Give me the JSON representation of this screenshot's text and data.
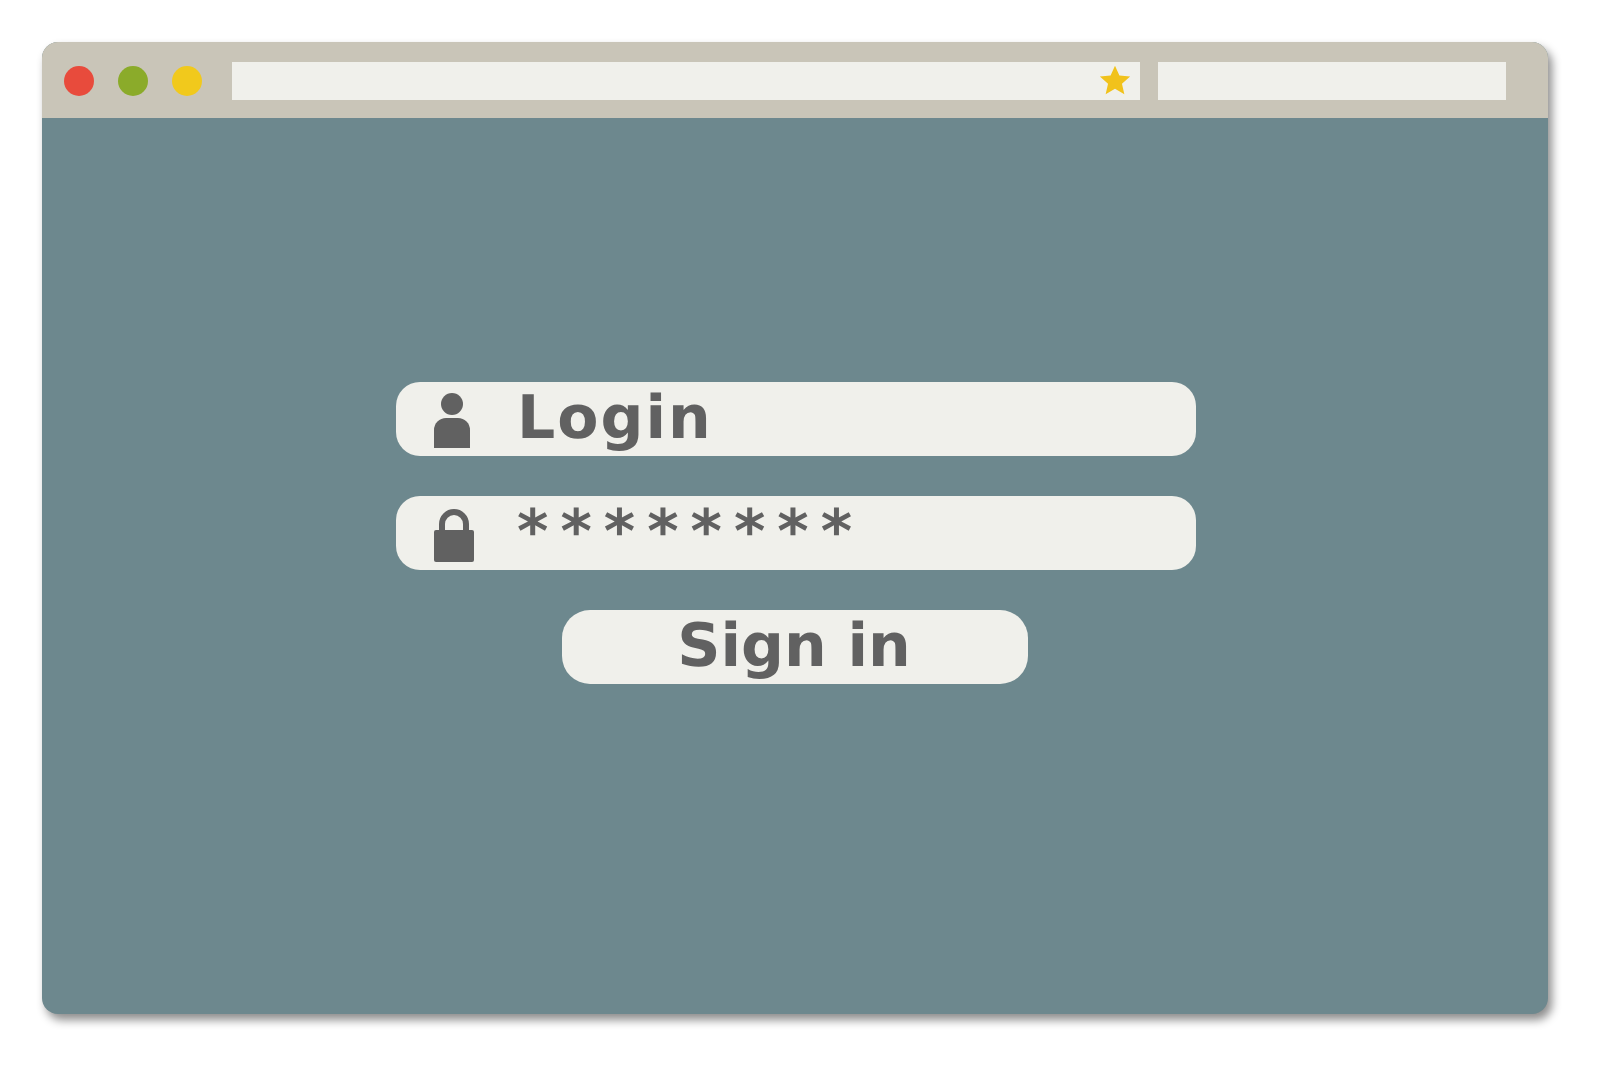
{
  "window": {
    "controls": [
      {
        "color": "#e84b3c"
      },
      {
        "color": "#8bab2a"
      },
      {
        "color": "#f1c91c"
      }
    ]
  },
  "login": {
    "placeholder": "Login"
  },
  "password": {
    "value": "********"
  },
  "button": "Sign in"
}
